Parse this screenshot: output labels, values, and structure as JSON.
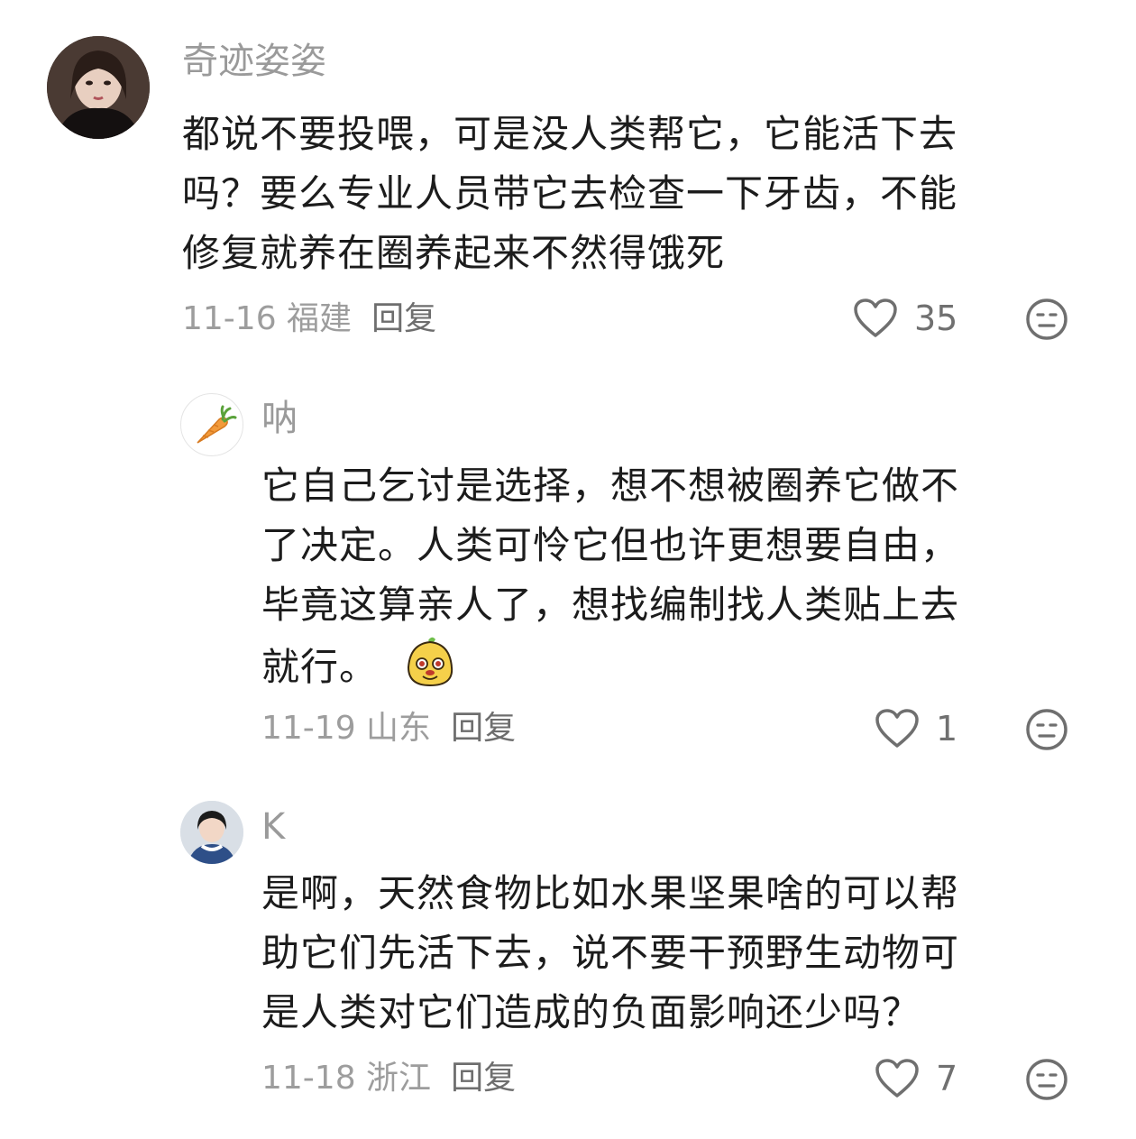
{
  "comments": [
    {
      "username": "奇迹姿姿",
      "lines": [
        "都说不要投喂，可是没人类帮它，它能活下去",
        "吗？要么专业人员带它去检查一下牙齿，不能",
        "修复就养在圈养起来不然得饿死"
      ],
      "date_location": "11-16 福建",
      "reply_label": "回复",
      "likes": "35",
      "like_icon": "heart-outline-icon",
      "dislike_icon": "neutral-face-icon"
    },
    {
      "username": "呐",
      "lines": [
        "它自己乞讨是选择，想不想被圈养它做不",
        "了决定。人类可怜它但也许更想要自由，",
        "毕竟这算亲人了，想找编制找人类贴上去",
        "就行。"
      ],
      "date_location": "11-19 山东",
      "reply_label": "回复",
      "likes": "1",
      "like_icon": "heart-outline-icon",
      "dislike_icon": "neutral-face-icon",
      "sticker": "yellow-blob-sticker"
    },
    {
      "username": "K",
      "lines": [
        "是啊，天然食物比如水果坚果啥的可以帮",
        "助它们先活下去，说不要干预野生动物可",
        "是人类对它们造成的负面影响还少吗？"
      ],
      "date_location": "11-18 浙江",
      "reply_label": "回复",
      "likes": "7",
      "like_icon": "heart-outline-icon",
      "dislike_icon": "neutral-face-icon"
    }
  ],
  "colors": {
    "text": "#1c1c1c",
    "muted": "#9a9a9a",
    "icon": "#707070"
  }
}
